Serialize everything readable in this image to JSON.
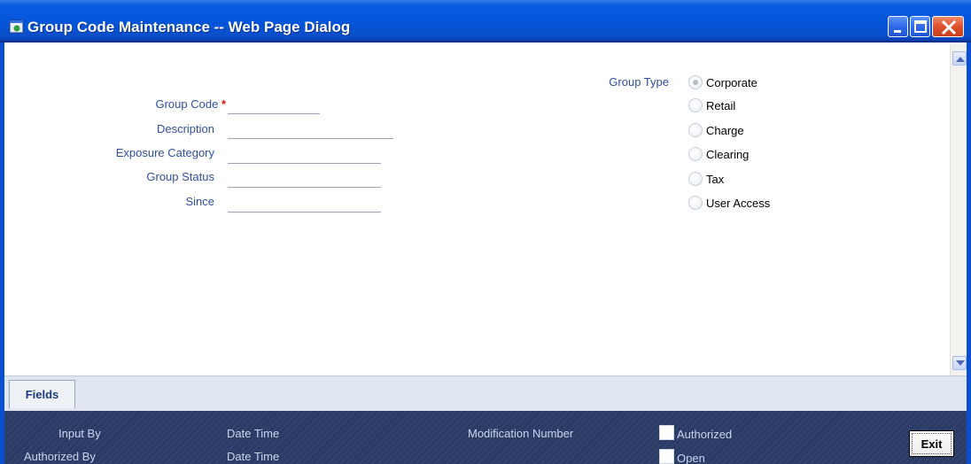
{
  "window": {
    "title": "Group Code Maintenance -- Web Page Dialog"
  },
  "form": {
    "group_code_label": "Group Code",
    "required_marker": "*",
    "description_label": "Description",
    "exposure_category_label": "Exposure Category",
    "group_status_label": "Group Status",
    "since_label": "Since",
    "group_code_value": "",
    "description_value": "",
    "exposure_category_value": "",
    "group_status_value": "",
    "since_value": ""
  },
  "group_type": {
    "label": "Group Type",
    "selected": "Corporate",
    "options": [
      "Corporate",
      "Retail",
      "Charge",
      "Clearing",
      "Tax",
      "User Access"
    ]
  },
  "tabs": [
    {
      "label": "Fields"
    }
  ],
  "footer": {
    "input_by_label": "Input By",
    "authorized_by_label": "Authorized By",
    "date_time_label_1": "Date Time",
    "date_time_label_2": "Date Time",
    "modification_number_label": "Modification Number",
    "authorized_label": "Authorized",
    "open_label": "Open",
    "exit_label": "Exit"
  },
  "colors": {
    "titlebar": "#0454d8",
    "label_blue": "#2f4f9e",
    "required_red": "#e01010",
    "footer_bg": "#2a3c66"
  }
}
